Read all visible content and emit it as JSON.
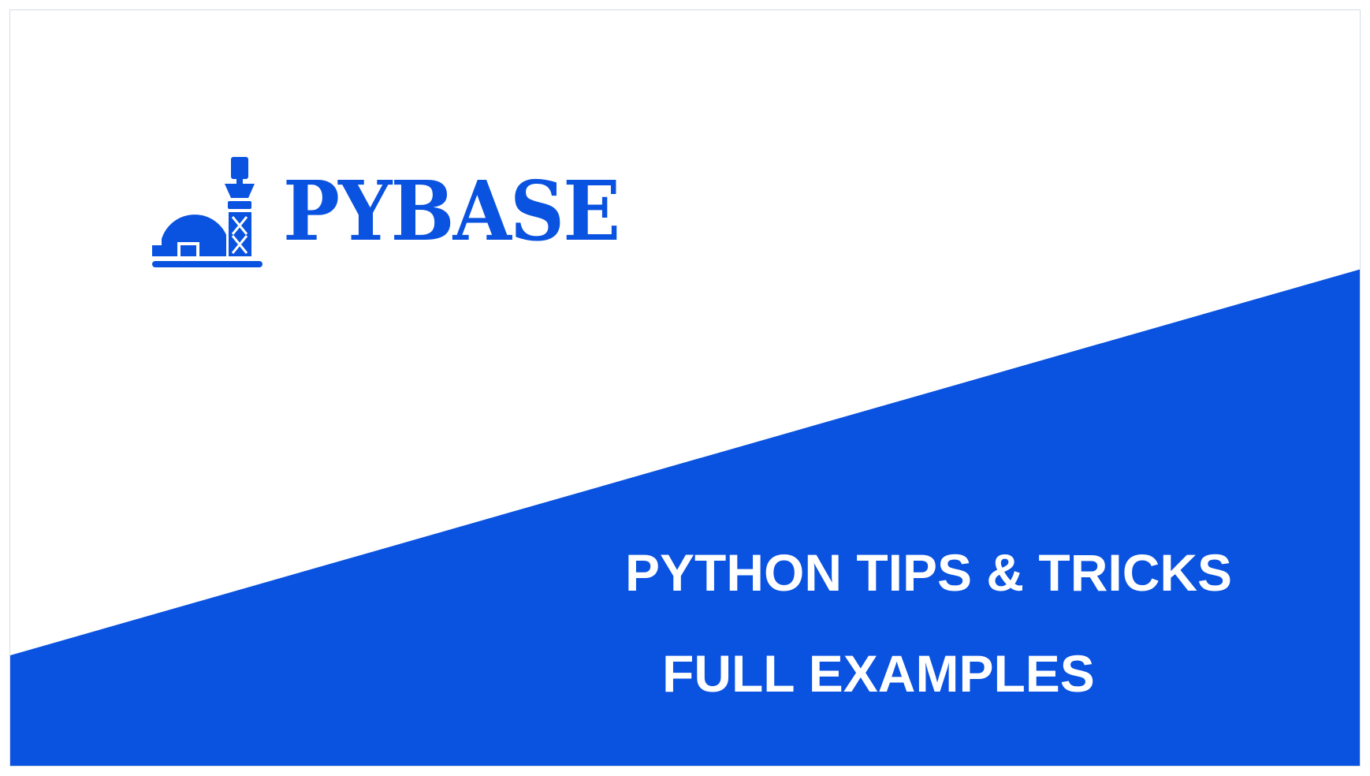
{
  "brand": {
    "name": "PYBASE",
    "logo_icon": "observatory-icon",
    "color": "#0a52e0"
  },
  "banner": {
    "line1": "PYTHON TIPS & TRICKS",
    "line2": "FULL EXAMPLES",
    "background_color": "#0a52e0",
    "text_color": "#ffffff"
  }
}
